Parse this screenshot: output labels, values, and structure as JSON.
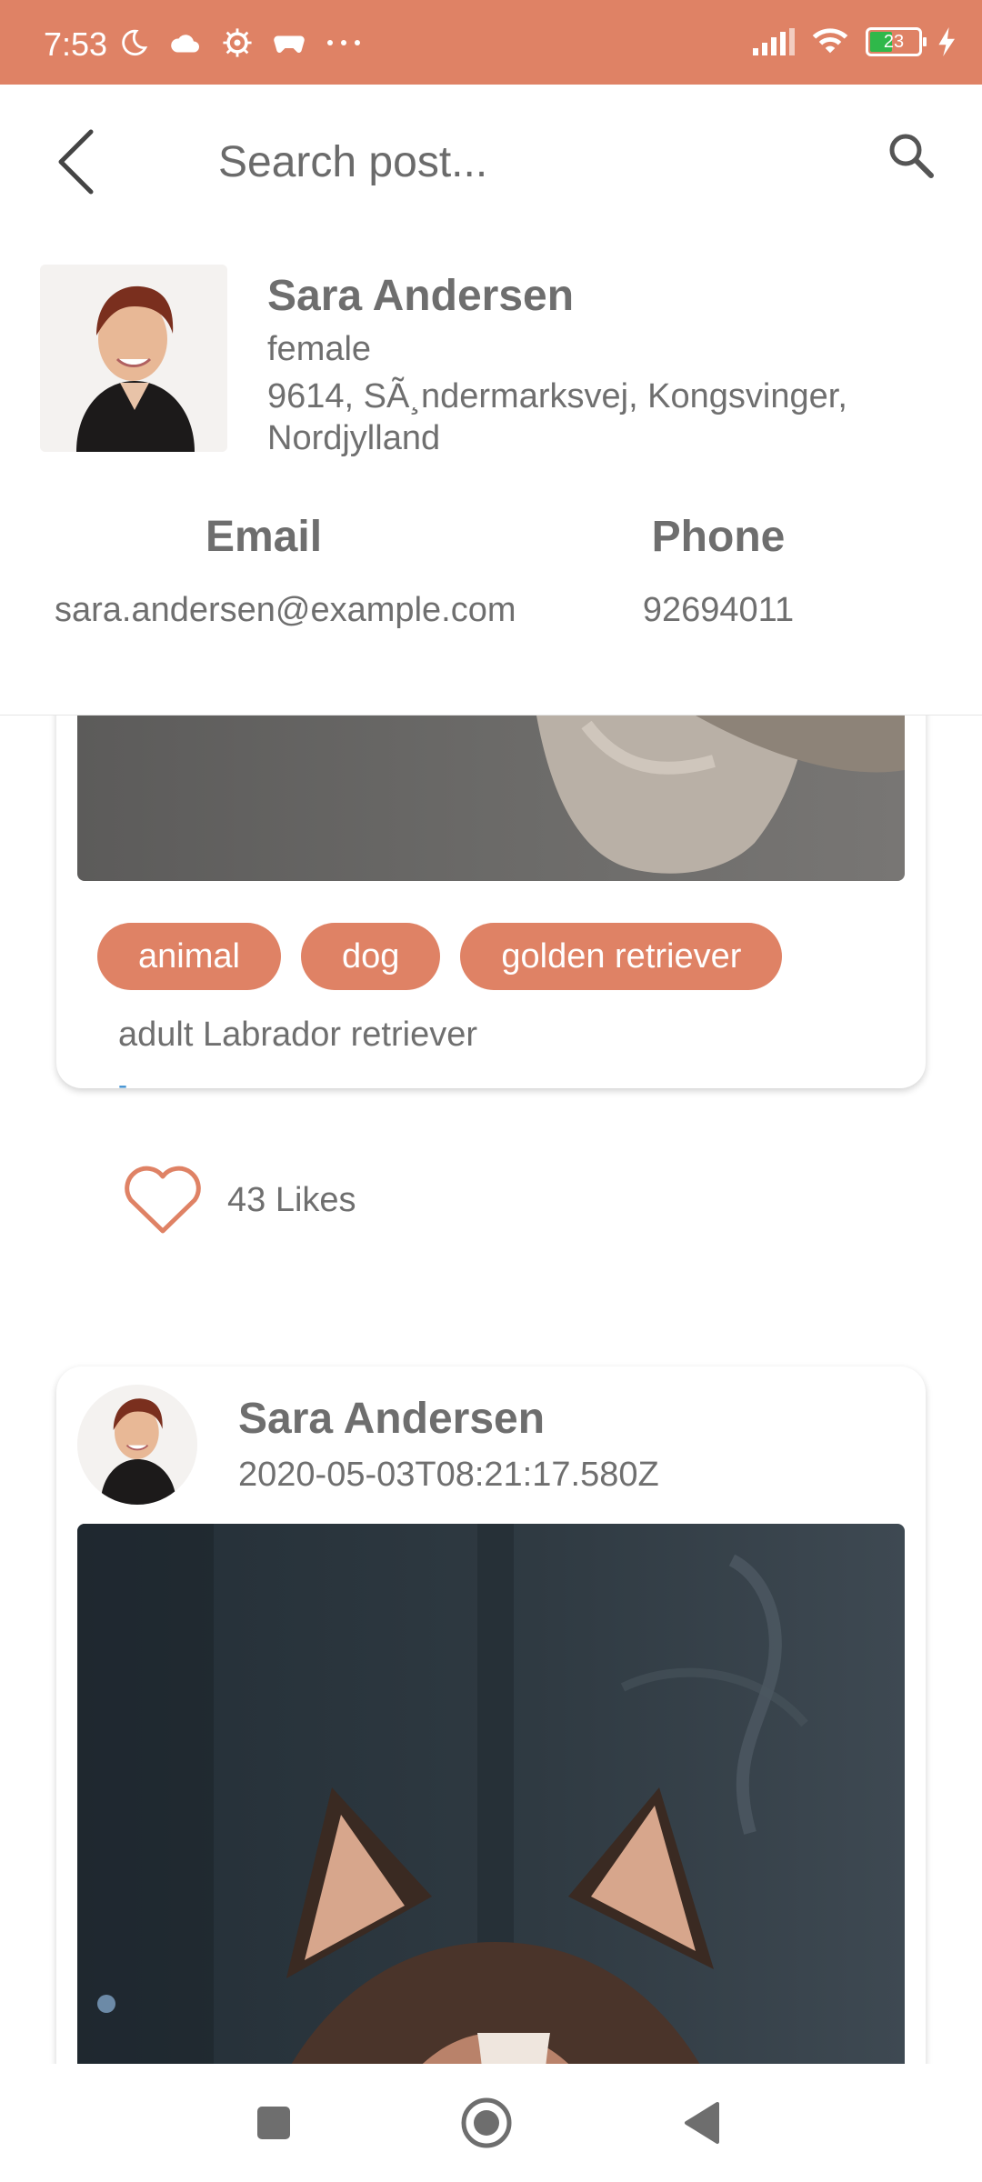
{
  "status_bar": {
    "time": "7:53",
    "battery_level": "23",
    "icons_left": [
      "moon-icon",
      "cloud-icon",
      "gear-icon",
      "gamepad-icon",
      "more-dots-icon"
    ],
    "icons_right": [
      "signal-icon",
      "wifi-icon",
      "battery-icon",
      "charging-icon"
    ],
    "background_color": "#df8265"
  },
  "header": {
    "search_placeholder": "Search post...",
    "icons": [
      "back-arrow-icon",
      "search-icon"
    ]
  },
  "profile": {
    "name": "Sara Andersen",
    "gender": "female",
    "address": "9614, SÃ¸ndermarksvej, Kongsvinger, Nordjylland",
    "email_label": "Email",
    "email": "sara.andersen@example.com",
    "phone_label": "Phone",
    "phone": "92694011"
  },
  "posts": [
    {
      "tags": [
        "animal",
        "dog",
        "golden retriever"
      ],
      "description": "adult Labrador retriever",
      "link_text": "-",
      "likes": "43 Likes"
    },
    {
      "author": "Sara Andersen",
      "date": "2020-05-03T08:21:17.580Z"
    }
  ],
  "colors": {
    "accent": "#df8265",
    "text": "#6f6f6f",
    "link": "#3d8fd0"
  },
  "nav_bar": {
    "icons": [
      "recents-square-icon",
      "home-circle-icon",
      "back-triangle-icon"
    ]
  }
}
